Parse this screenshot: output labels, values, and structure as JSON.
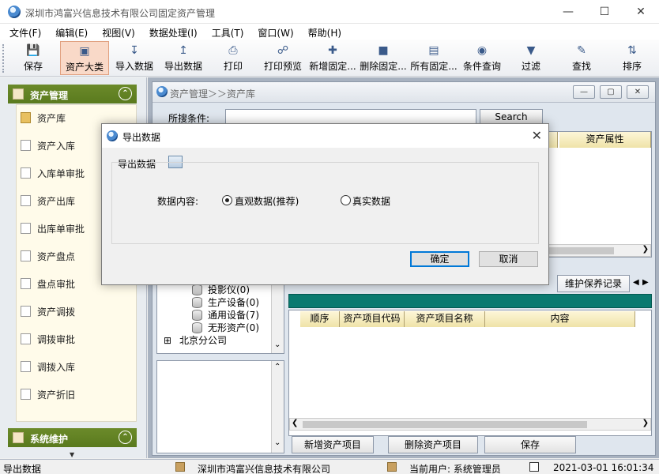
{
  "window": {
    "title": "深圳市鸿富兴信息技术有限公司固定资产管理"
  },
  "menu": [
    "文件(F)",
    "编辑(E)",
    "视图(V)",
    "数据处理(I)",
    "工具(T)",
    "窗口(W)",
    "帮助(H)"
  ],
  "toolbar": [
    {
      "label": "保存",
      "icon": "floppy-disk-icon"
    },
    {
      "label": "资产大类",
      "icon": "asset-category-icon",
      "active": true
    },
    {
      "label": "导入数据",
      "icon": "import-icon"
    },
    {
      "label": "导出数据",
      "icon": "export-icon"
    },
    {
      "label": "打印",
      "icon": "printer-icon"
    },
    {
      "label": "打印预览",
      "icon": "print-preview-icon"
    },
    {
      "label": "新增固定...",
      "icon": "add-asset-icon"
    },
    {
      "label": "删除固定...",
      "icon": "delete-asset-icon"
    },
    {
      "label": "所有固定...",
      "icon": "all-assets-icon"
    },
    {
      "label": "条件查询",
      "icon": "query-icon"
    },
    {
      "label": "过滤",
      "icon": "filter-icon"
    },
    {
      "label": "查找",
      "icon": "find-icon"
    },
    {
      "label": "排序",
      "icon": "sort-icon"
    }
  ],
  "sidebar": {
    "group1": "资产管理",
    "items": [
      "资产库",
      "资产入库",
      "入库单审批",
      "资产出库",
      "出库单审批",
      "资产盘点",
      "盘点审批",
      "资产调拨",
      "调拨审批",
      "调拨入库",
      "资产折旧"
    ],
    "group2": "系统维护"
  },
  "child": {
    "title": "资产管理＞＞资产库",
    "search_label": "所搜条件:",
    "search_value": "",
    "search_button": "Search",
    "top_grid_header": "资产属性",
    "tab_label": "维护保养记录",
    "tree": [
      "投影仪(0)",
      "生产设备(0)",
      "通用设备(7)",
      "无形资产(0)",
      "北京分公司"
    ],
    "bottom_grid_headers": [
      "顺序",
      "资产项目代码",
      "资产项目名称",
      "内容"
    ],
    "buttons": [
      "新增资产项目",
      "删除资产项目",
      "保存"
    ]
  },
  "dialog": {
    "title": "导出数据",
    "section_label": "导出数据",
    "content_label": "数据内容:",
    "options": [
      {
        "label": "直观数据(推荐)",
        "selected": true
      },
      {
        "label": "真实数据",
        "selected": false
      }
    ],
    "ok": "确定",
    "cancel": "取消"
  },
  "status": {
    "left": "导出数据",
    "company": "深圳市鸿富兴信息技术有限公司",
    "user": "当前用户: 系统管理员",
    "datetime": "2021-03-01 16:01:34"
  }
}
